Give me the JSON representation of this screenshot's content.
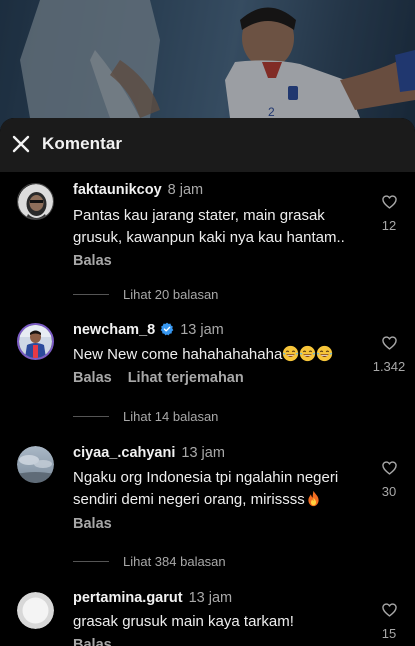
{
  "header": {
    "title": "Komentar"
  },
  "comments": [
    {
      "username": "faktaunikcoy",
      "time": "8 jam",
      "text": "Pantas kau jarang stater, main grasak grusuk, kawanpun kaki nya kau hantam..",
      "reply_label": "Balas",
      "likes": "12",
      "view_replies": "Lihat 20 balasan"
    },
    {
      "username": "newcham_8",
      "verified": true,
      "time": "13 jam",
      "text": "New New come hahahahahaha",
      "reply_label": "Balas",
      "translate_label": "Lihat terjemahan",
      "likes": "1.342",
      "view_replies": "Lihat 14 balasan"
    },
    {
      "username": "ciyaa_.cahyani",
      "time": "13 jam",
      "text": "Ngaku org Indonesia tpi ngalahin negeri sendiri demi negeri orang, mirissss",
      "reply_label": "Balas",
      "likes": "30",
      "view_replies": "Lihat 384 balasan"
    },
    {
      "username": "pertamina.garut",
      "time": "13 jam",
      "text": "grasak grusuk main kaya tarkam!",
      "reply_label": "Balas",
      "likes": "15"
    }
  ],
  "icons": {
    "close": "close-icon",
    "like": "heart-outline-icon",
    "verified": "verified-badge-icon",
    "emoji_laugh": "tears-of-joy-emoji",
    "emoji_fire": "fire-emoji"
  },
  "colors": {
    "background": "#000000",
    "header": "#1b1b1b",
    "muted_text": "#a8a8a8",
    "verified_blue": "#3797f0"
  }
}
